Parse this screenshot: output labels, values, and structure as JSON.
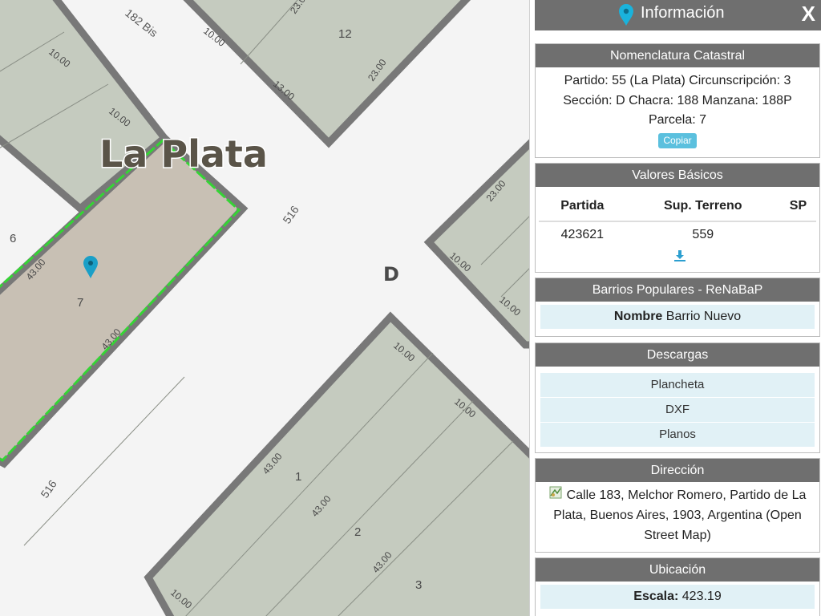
{
  "map": {
    "city_label": "La Plata",
    "section_label": "D",
    "streets": [
      "182 Bis",
      "516",
      "516"
    ],
    "parcels": [
      "12",
      "6",
      "7",
      "1",
      "2",
      "3"
    ],
    "dimensions": {
      "a": "10.00",
      "b": "23.0",
      "c": "10.00",
      "d": "23.00",
      "e": "13.00",
      "f": "10.00",
      "g": "43.00",
      "h": "43.00",
      "i": "23.00",
      "j": "10.00",
      "k": "10.00",
      "l": "10.00",
      "m": "10.00",
      "n": "43.00",
      "o": "43.00",
      "p": "43.00",
      "q": "10.00"
    },
    "colors": {
      "block": "#c5cbbf",
      "block_border": "#787878",
      "selected_fill": "#c8c0b4",
      "selected_border": "#35d435",
      "pin": "#1a9fc7",
      "background": "#f4f4f4"
    }
  },
  "panel": {
    "title": "Información",
    "close_label": "X",
    "nomenclatura": {
      "heading": "Nomenclatura Catastral",
      "line1": "Partido: 55 (La Plata) Circunscripción: 3",
      "line2": "Sección: D Chacra: 188 Manzana: 188P",
      "line3": "Parcela: 7",
      "copy_label": "Copiar"
    },
    "valores": {
      "heading": "Valores Básicos",
      "columns": [
        "Partida",
        "Sup. Terreno",
        "SP"
      ],
      "row": [
        "423621",
        "559",
        ""
      ]
    },
    "barrios": {
      "heading": "Barrios Populares - ReNaBaP",
      "label": "Nombre",
      "value": "Barrio Nuevo"
    },
    "descargas": {
      "heading": "Descargas",
      "items": [
        "Plancheta",
        "DXF",
        "Planos"
      ]
    },
    "direccion": {
      "heading": "Dirección",
      "text": "Calle 183, Melchor Romero, Partido de La Plata, Buenos Aires, 1903, Argentina (Open Street Map)"
    },
    "ubicacion": {
      "heading": "Ubicación",
      "label": "Escala:",
      "value": "423.19"
    }
  }
}
